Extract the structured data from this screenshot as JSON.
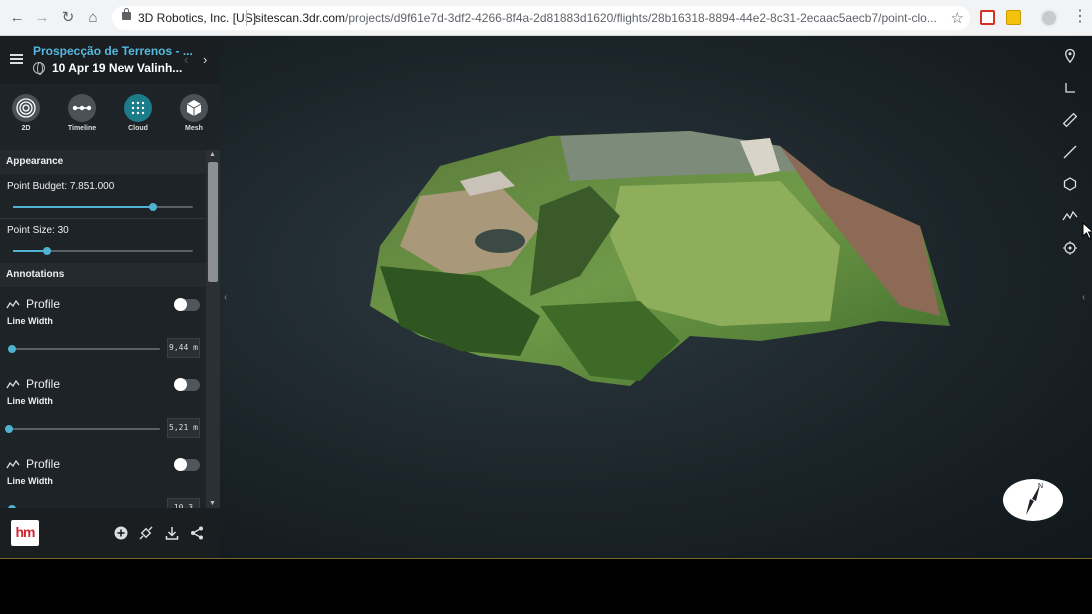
{
  "browser": {
    "site_name": "3D Robotics, Inc. [US]",
    "url_host": "sitescan.3dr.com",
    "url_path": "/projects/d9f61e7d-3df2-4266-8f4a-2d81883d1620/flights/28b16318-8894-44e2-8c31-2ecaac5aecb7/point-clo..."
  },
  "header": {
    "project_title": "Prospecção de Terrenos - ...",
    "flight_date": "10 Apr 19  New Valinh..."
  },
  "modes": [
    {
      "label": "2D",
      "icon": "fingerprint-icon"
    },
    {
      "label": "Timeline",
      "icon": "timeline-icon"
    },
    {
      "label": "Cloud",
      "icon": "point-cloud-icon"
    },
    {
      "label": "Mesh",
      "icon": "mesh-cube-icon"
    }
  ],
  "appearance": {
    "heading": "Appearance",
    "point_budget_label": "Point Budget: 7.851.000",
    "point_budget_fraction": 0.78,
    "point_size_label": "Point Size: 30",
    "point_size_fraction": 0.19
  },
  "annotations": {
    "heading": "Annotations",
    "items": [
      {
        "title": "Profile",
        "sub": "Line Width",
        "value": "9,44 m",
        "fraction": 0.0,
        "enabled": false
      },
      {
        "title": "Profile",
        "sub": "Line Width",
        "value": "5,21 m",
        "fraction": 0.0,
        "enabled": false
      },
      {
        "title": "Profile",
        "sub": "Line Width",
        "value": "10,3",
        "fraction": 0.0,
        "enabled": false
      }
    ]
  },
  "footer": {
    "logo_text": "hm"
  },
  "colors": {
    "accent": "#4fb3cf",
    "title": "#55b9e0",
    "sidebar_bg": "#1e2327"
  }
}
